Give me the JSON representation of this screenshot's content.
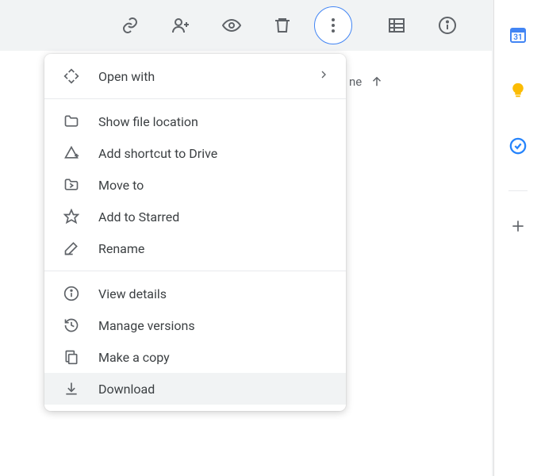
{
  "toolbar": {
    "icons": {
      "link": "link-icon",
      "share": "person-add-icon",
      "preview": "eye-icon",
      "delete": "trash-icon",
      "more": "more-vert-icon",
      "layout": "list-layout-icon",
      "info": "info-icon"
    }
  },
  "header": {
    "partial_label": "ne",
    "sort_arrow": "arrow-up-icon"
  },
  "menu": {
    "open_with": "Open with",
    "items_group1": [
      {
        "icon": "folder-icon",
        "label": "Show file location"
      },
      {
        "icon": "add-shortcut-icon",
        "label": "Add shortcut to Drive"
      },
      {
        "icon": "move-to-icon",
        "label": "Move to"
      },
      {
        "icon": "star-icon",
        "label": "Add to Starred"
      },
      {
        "icon": "rename-icon",
        "label": "Rename"
      }
    ],
    "items_group2": [
      {
        "icon": "info-outline-icon",
        "label": "View details"
      },
      {
        "icon": "versions-icon",
        "label": "Manage versions"
      },
      {
        "icon": "copy-icon",
        "label": "Make a copy"
      },
      {
        "icon": "download-icon",
        "label": "Download",
        "highlight": true
      }
    ]
  },
  "sidepanel": {
    "calendar": "calendar-icon",
    "keep": "keep-icon",
    "tasks": "tasks-icon",
    "add": "plus-icon"
  }
}
